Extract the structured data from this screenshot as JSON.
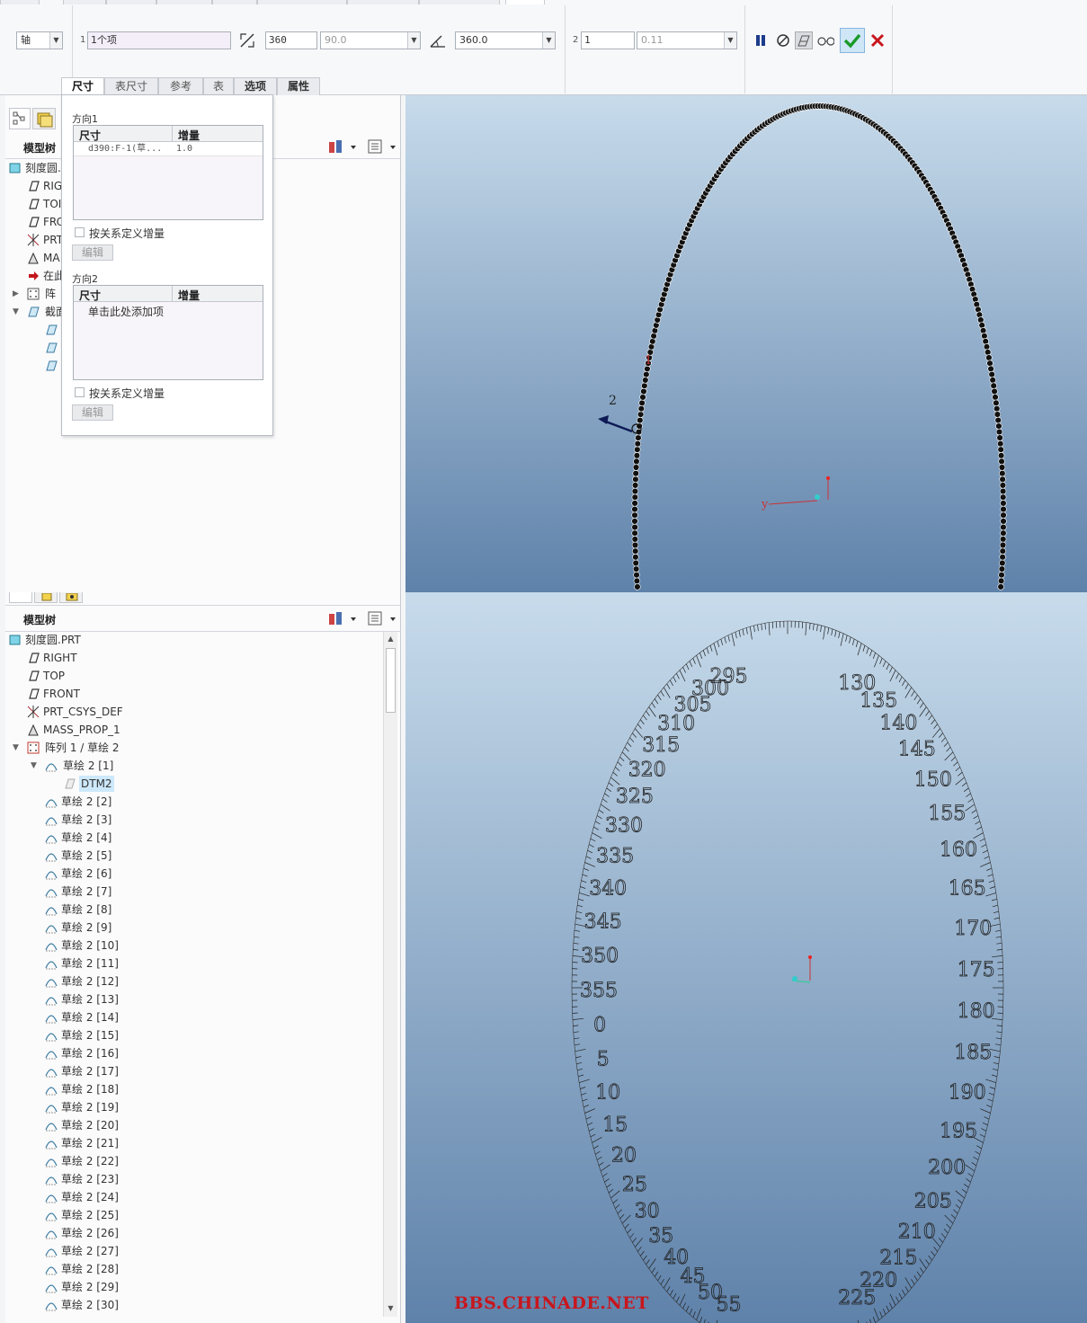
{
  "ribbon": {
    "pattern_type": "轴",
    "dir1_count_label": "1",
    "dir1_items": "1个项",
    "angle_total": "360",
    "angle_increment": "90.0",
    "angle_extent": "360.0",
    "dir2_count_label": "2",
    "dir2_count": "1",
    "dir2_increment": "0.11"
  },
  "subtabs": [
    "尺寸",
    "表尺寸",
    "参考",
    "表",
    "选项",
    "属性"
  ],
  "panel": {
    "dir1_title": "方向1",
    "dir2_title": "方向2",
    "col_dim": "尺寸",
    "col_inc": "增量",
    "row_dim": "d390:F-1(草...",
    "row_inc": "1.0",
    "add_hint": "单击此处添加项",
    "relation_label": "按关系定义增量",
    "edit_label": "编辑"
  },
  "tree_top": {
    "title": "模型树",
    "rows": [
      "刻度圆.",
      "RIG",
      "TOI",
      "FRC",
      "PRT",
      "MA",
      "在此",
      "阵",
      "截面"
    ]
  },
  "tree_bottom": {
    "title": "模型树",
    "root": "刻度圆.PRT",
    "datums": [
      "RIGHT",
      "TOP",
      "FRONT",
      "PRT_CSYS_DEF",
      "MASS_PROP_1"
    ],
    "pattern": "阵列 1 / 草绘 2",
    "first_child": "草绘 2 [1]",
    "selected_child": "DTM2",
    "sketches": [
      "草绘 2 [2]",
      "草绘 2 [3]",
      "草绘 2 [4]",
      "草绘 2 [5]",
      "草绘 2 [6]",
      "草绘 2 [7]",
      "草绘 2 [8]",
      "草绘 2 [9]",
      "草绘 2 [10]",
      "草绘 2 [11]",
      "草绘 2 [12]",
      "草绘 2 [13]",
      "草绘 2 [14]",
      "草绘 2 [15]",
      "草绘 2 [16]",
      "草绘 2 [17]",
      "草绘 2 [18]",
      "草绘 2 [19]",
      "草绘 2 [20]",
      "草绘 2 [21]",
      "草绘 2 [22]",
      "草绘 2 [23]",
      "草绘 2 [24]",
      "草绘 2 [25]",
      "草绘 2 [26]",
      "草绘 2 [27]",
      "草绘 2 [28]",
      "草绘 2 [29]",
      "草绘 2 [30]"
    ]
  },
  "viewport_top": {
    "label_1": "1",
    "label_2": "2",
    "axis_y": "y"
  },
  "viewport_bottom": {
    "scale_left": [
      "55",
      "50",
      "45",
      "40",
      "35",
      "30",
      "25",
      "20",
      "15",
      "10",
      "5",
      "0",
      "355",
      "350",
      "345",
      "340",
      "335",
      "330",
      "325",
      "320",
      "315",
      "310",
      "305",
      "300",
      "295"
    ],
    "scale_right": [
      "130",
      "135",
      "140",
      "145",
      "150",
      "155",
      "160",
      "165",
      "170",
      "175",
      "180",
      "185",
      "190",
      "195",
      "200",
      "205",
      "210",
      "215",
      "220",
      "225"
    ],
    "watermark": "BBS.CHINADE.NET"
  },
  "colors": {
    "accent_green": "#1a9a2a",
    "cancel_red": "#c8161d",
    "pause_blue": "#1c3c8c"
  }
}
